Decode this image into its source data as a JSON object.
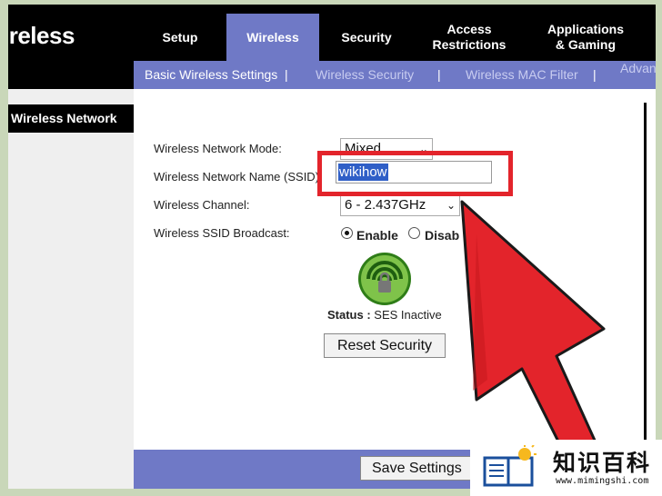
{
  "brand": {
    "title": "ireless"
  },
  "tabs": [
    {
      "label": "Setup"
    },
    {
      "label": "Wireless"
    },
    {
      "label": "Security"
    },
    {
      "label": "Access\nRestrictions"
    },
    {
      "label": "Applications\n& Gaming"
    }
  ],
  "subnav": {
    "items": [
      "Basic Wireless Settings",
      "Wireless Security",
      "Wireless MAC Filter",
      "Advan"
    ],
    "separator": "|"
  },
  "sidebar": {
    "header": "Wireless Network"
  },
  "form": {
    "mode_label": "Wireless Network Mode:",
    "mode_value": "Mixed",
    "name_label": "Wireless Network Name (SSID):",
    "name_value": "wikihow",
    "channel_label": "Wireless Channel:",
    "channel_value": "6 - 2.437GHz",
    "broadcast_label": "Wireless SSID Broadcast:",
    "broadcast_enable": "Enable",
    "broadcast_disable": "Disab",
    "status_label": "Status :",
    "status_value": "SES Inactive",
    "reset_button": "Reset Security",
    "save_button": "Save Settings"
  },
  "watermark": {
    "title": "知识百科",
    "url": "www.mimingshi.com"
  },
  "colors": {
    "accent": "#6f79c6",
    "highlight": "#e3242b",
    "arrow": "#e3242b"
  }
}
